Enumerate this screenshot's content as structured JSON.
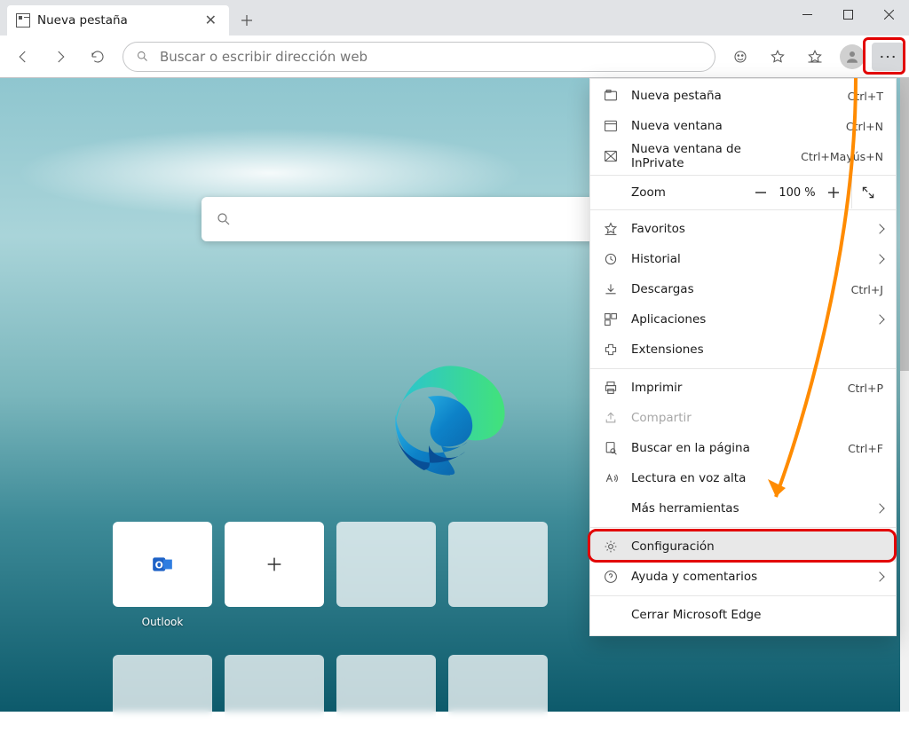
{
  "tab": {
    "title": "Nueva pestaña"
  },
  "omnibox": {
    "placeholder": "Buscar o escribir dirección web"
  },
  "tiles": {
    "outlook": "Outlook"
  },
  "menu": {
    "new_tab": {
      "label": "Nueva pestaña",
      "accel": "Ctrl+T"
    },
    "new_window": {
      "label": "Nueva ventana",
      "accel": "Ctrl+N"
    },
    "new_private": {
      "label": "Nueva ventana de InPrivate",
      "accel": "Ctrl+Mayús+N"
    },
    "zoom": {
      "label": "Zoom",
      "value": "100 %"
    },
    "favorites": {
      "label": "Favoritos"
    },
    "history": {
      "label": "Historial"
    },
    "downloads": {
      "label": "Descargas",
      "accel": "Ctrl+J"
    },
    "apps": {
      "label": "Aplicaciones"
    },
    "extensions": {
      "label": "Extensiones"
    },
    "print": {
      "label": "Imprimir",
      "accel": "Ctrl+P"
    },
    "share": {
      "label": "Compartir"
    },
    "find": {
      "label": "Buscar en la página",
      "accel": "Ctrl+F"
    },
    "read_aloud": {
      "label": "Lectura en voz alta"
    },
    "more_tools": {
      "label": "Más herramientas"
    },
    "settings": {
      "label": "Configuración"
    },
    "help": {
      "label": "Ayuda y comentarios"
    },
    "close": {
      "label": "Cerrar Microsoft Edge"
    }
  }
}
